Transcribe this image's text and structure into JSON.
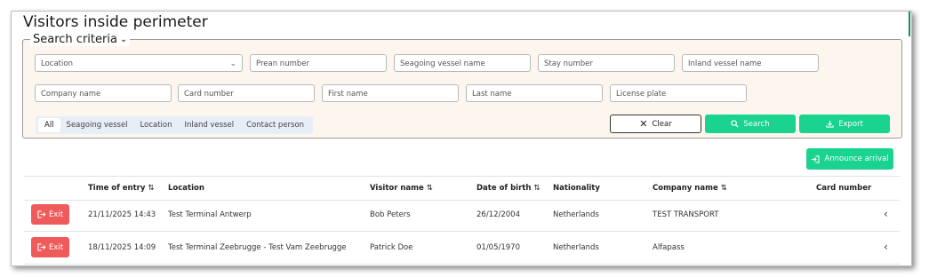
{
  "page": {
    "title": "Visitors inside perimeter"
  },
  "criteria": {
    "legend": "Search criteria",
    "row1": [
      "Location",
      "Prean number",
      "Seagoing vessel name",
      "Stay number",
      "Inland vessel name"
    ],
    "row2": [
      "Company name",
      "Card number",
      "First name",
      "Last name",
      "License plate"
    ],
    "chips": [
      "All",
      "Seagoing vessel",
      "Location",
      "Inland vessel",
      "Contact person"
    ],
    "active_chip": "All",
    "buttons": {
      "clear": "Clear",
      "search": "Search",
      "export": "Export"
    }
  },
  "actions": {
    "announce": "Announce arrival"
  },
  "table": {
    "columns": [
      "Time of entry",
      "Location",
      "Visitor name",
      "Date of birth",
      "Nationality",
      "Company name",
      "Card number"
    ],
    "sortable": [
      "Time of entry",
      "Visitor name",
      "Date of birth",
      "Company name"
    ],
    "exit_label": "Exit",
    "rows": [
      {
        "time": "21/11/2025 14:43",
        "location": "Test Terminal Antwerp",
        "visitor": "Bob Peters",
        "dob": "26/12/2004",
        "nationality": "Netherlands",
        "company": "TEST TRANSPORT",
        "card": ""
      },
      {
        "time": "18/11/2025 14:09",
        "location": "Test Terminal Zeebrugge - Test Vam Zeebrugge",
        "visitor": "Patrick Doe",
        "dob": "01/05/1970",
        "nationality": "Netherlands",
        "company": "Alfapass",
        "card": ""
      }
    ]
  },
  "colors": {
    "accent_green": "#19d38e",
    "exit_red": "#ef5b5b",
    "criteria_bg": "#fdf6ef"
  }
}
